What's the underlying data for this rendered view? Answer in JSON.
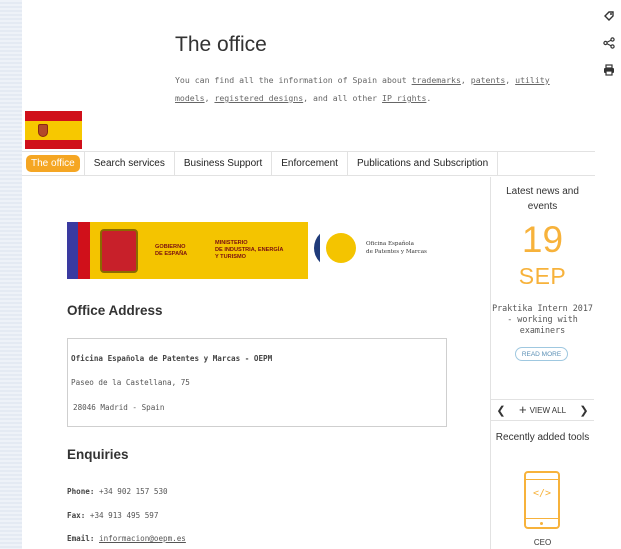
{
  "side_tools": [
    {
      "name": "tag-icon",
      "glyph": "◈"
    },
    {
      "name": "share-icon",
      "glyph": "⋖"
    },
    {
      "name": "print-icon",
      "glyph": "⎙"
    }
  ],
  "page": {
    "title": "The office",
    "intro": {
      "prefix": "You can find all the information of Spain about ",
      "links": [
        "trademarks",
        "patents",
        "utility models",
        "registered designs"
      ],
      "sep1": ", ",
      "sep2": ", ",
      "sep3": ", ",
      "middle": ", and all other ",
      "last_link": "IP rights",
      "suffix": "."
    }
  },
  "nav": {
    "tabs": [
      {
        "label": "The office",
        "active": true
      },
      {
        "label": "Search services",
        "active": false
      },
      {
        "label": "Business Support",
        "active": false
      },
      {
        "label": "Enforcement",
        "active": false
      },
      {
        "label": "Publications and Subscription",
        "active": false
      }
    ]
  },
  "logos": {
    "gobierno": "GOBIERNO\nDE ESPAÑA",
    "ministerio": "MINISTERIO\nDE INDUSTRIA, ENERGÍA\nY TURISMO",
    "oepm": "Oficina Española\nde Patentes y Marcas"
  },
  "office_address": {
    "heading": "Office Address",
    "lines": [
      "Oficina Española de Patentes y Marcas - OEPM",
      "Paseo de la Castellana, 75",
      "28046 Madrid - Spain"
    ]
  },
  "enquiries": {
    "heading": "Enquiries",
    "phone_label": "Phone:",
    "phone": "+34 902 157 530",
    "fax_label": "Fax:",
    "fax": "+34 913 495 597",
    "email_label": "Email:",
    "email": "informacion@oepm.es"
  },
  "aside": {
    "news_title": "Latest news and events",
    "day": "19",
    "month": "SEP",
    "event_title": "Praktika Intern 2017 - working with examiners",
    "read_more": "READ MORE",
    "prev": "❮",
    "next": "❯",
    "view_all": "VIEW ALL",
    "tools_title": "Recently added tools",
    "tool_name": "CEO"
  },
  "colors": {
    "accent": "#f5a623",
    "news_accent": "#f7b23b",
    "link_blue": "#5a8fb5"
  }
}
